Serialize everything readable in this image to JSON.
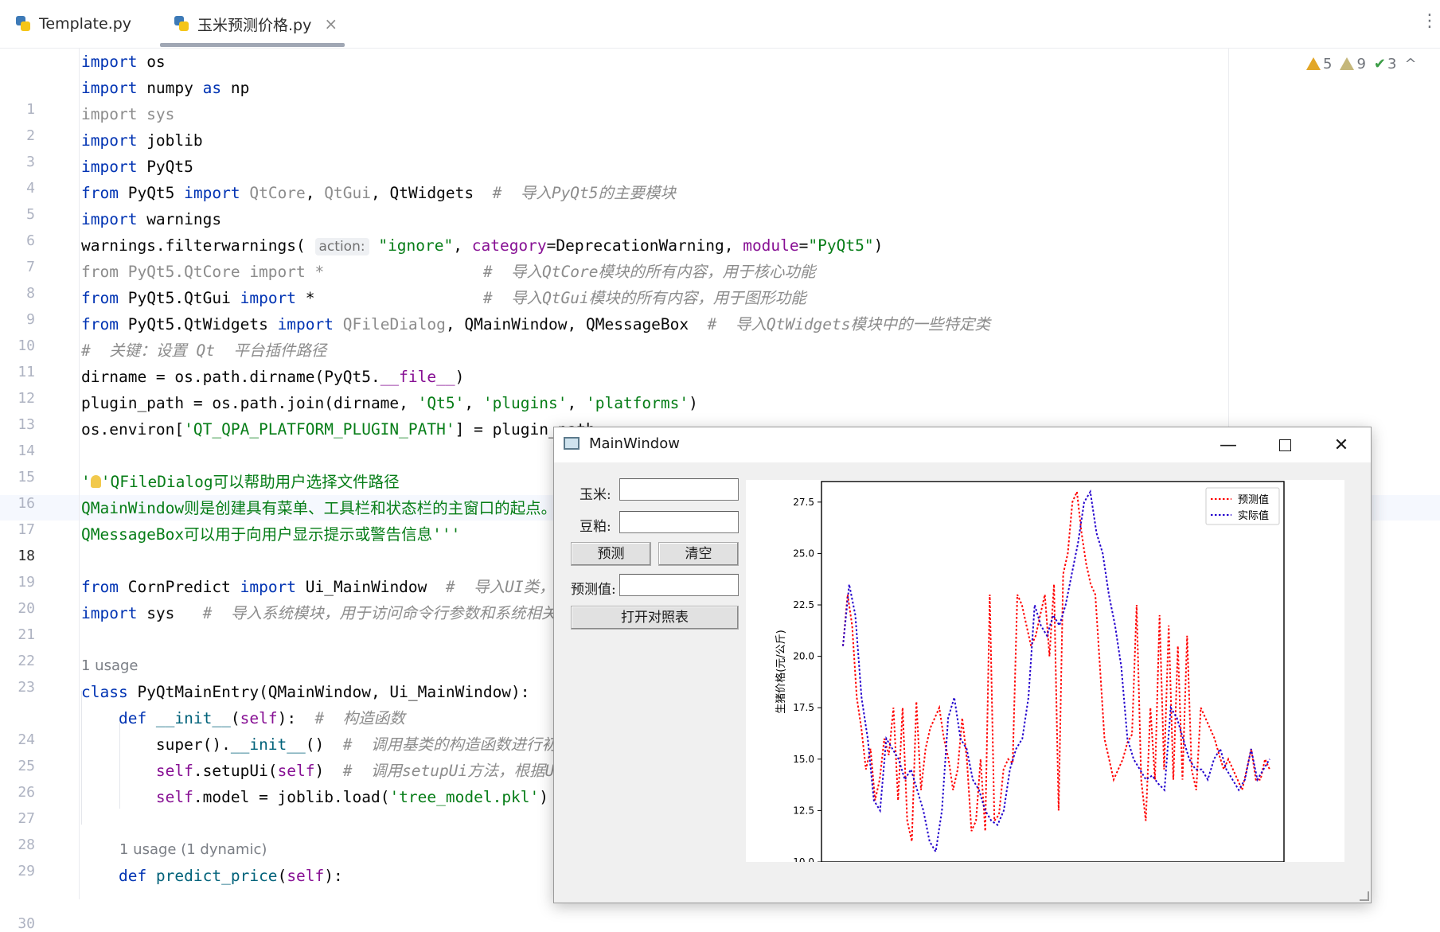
{
  "tabs": [
    {
      "label": "Template.py"
    },
    {
      "label": "玉米预测价格.py",
      "close": "×"
    }
  ],
  "tab_menu": "⋮",
  "inspections": {
    "warnings": "5",
    "weak_warnings": "9",
    "typos": "3",
    "collapse": "^"
  },
  "gutter_numbers": [
    "1",
    "2",
    "3",
    "4",
    "5",
    "6",
    "7",
    "8",
    "9",
    "10",
    "11",
    "12",
    "13",
    "14",
    "15",
    "16",
    "17",
    "18",
    "19",
    "20",
    "21",
    "22",
    "23",
    "24",
    "25",
    "26",
    "27",
    "28",
    "29",
    "30"
  ],
  "code": {
    "l1": [
      "import",
      " os"
    ],
    "l2": [
      "import",
      " numpy ",
      "as",
      " np"
    ],
    "l3": [
      "import sys"
    ],
    "l4": [
      "import",
      " joblib"
    ],
    "l5": [
      "import",
      " PyQt5"
    ],
    "l6": [
      "from",
      " PyQt5 ",
      "import",
      " QtCore",
      ", ",
      "QtGui",
      ", QtWidgets  ",
      "#  导入PyQt5的主要模块"
    ],
    "l7": [
      "import",
      " warnings"
    ],
    "l8": [
      "warnings.filterwarnings(",
      "action:",
      "\"ignore\"",
      ", ",
      "category",
      "=DeprecationWarning, ",
      "module",
      "=",
      "\"PyQt5\"",
      ")"
    ],
    "l9": [
      "from PyQt5.QtCore import *",
      "                 #  导入QtCore模块的所有内容，用于核心功能"
    ],
    "l10": [
      "from",
      " PyQt5.QtGui ",
      "import",
      " *",
      "                  #  导入QtGui模块的所有内容，用于图形功能"
    ],
    "l11": [
      "from",
      " PyQt5.QtWidgets ",
      "import",
      " QFileDialog",
      ", QMainWindow, QMessageBox  ",
      "#  导入QtWidgets模块中的一些特定类"
    ],
    "l12": [
      "#  关键：设置 Qt  平台插件路径"
    ],
    "l13": [
      "dirname = os.path.dirname(PyQt5.",
      "__file__",
      ")"
    ],
    "l14": [
      "plugin_path = os.path.join(dirname, ",
      "'Qt5'",
      ", ",
      "'plugins'",
      ", ",
      "'platforms'",
      ")"
    ],
    "l15": [
      "os.environ[",
      "'QT_QPA_PLATFORM_PLUGIN_PATH'",
      "] = plugin_path"
    ],
    "l17": [
      "'",
      "'QFileDialog可以帮助用户选择文件路径"
    ],
    "l18": [
      "QMainWindow则是创建具有菜单、工具栏和状态栏的主窗口的起点。"
    ],
    "l19": [
      "QMessageBox可以用于向用户显示提示或警告信息'''"
    ],
    "l21": [
      "from",
      " CornPredict ",
      "import",
      " Ui_MainWindow  ",
      "#  导入UI类，"
    ],
    "l22": [
      "import",
      " sys   ",
      "#  导入系统模块，用于访问命令行参数和系统相关功"
    ],
    "usage1": "1 usage",
    "l24": [
      "class",
      " PyQtMainEntry(QMainWindow, Ui_MainWindow):"
    ],
    "l25": [
      "    def",
      " __init__",
      "(",
      "self",
      "):  ",
      "#  构造函数"
    ],
    "l26": [
      "        super().",
      "__init__",
      "()  ",
      "#  调用基类的构造函数进行初"
    ],
    "l27": [
      "        ",
      "self",
      ".setupUi(",
      "self",
      ")  ",
      "#  调用setupUi方法，根据Ui"
    ],
    "l28": [
      "        ",
      "self",
      ".model = joblib.load(",
      "'tree_model.pkl'",
      ")"
    ],
    "usage2": "1 usage (1 dynamic)",
    "l30": [
      "    def",
      " predict_price",
      "(",
      "self",
      "):"
    ]
  },
  "qt_window": {
    "title": "MainWindow",
    "min": "—",
    "close": "✕",
    "labels": {
      "corn": "玉米:",
      "soy": "豆粕:",
      "pred": "预测值:"
    },
    "inputs": {
      "corn": "",
      "soy": "",
      "pred": ""
    },
    "buttons": {
      "predict": "预测",
      "clear": "清空",
      "open_table": "打开对照表"
    }
  },
  "chart_data": {
    "type": "line",
    "ylabel": "生猪价格(元/公斤)",
    "ylim": [
      10.0,
      28.5
    ],
    "yticks": [
      "10.0",
      "12.5",
      "15.0",
      "17.5",
      "20.0",
      "22.5",
      "25.0",
      "27.5"
    ],
    "ytick_values": [
      10.0,
      12.5,
      15.0,
      17.5,
      20.0,
      22.5,
      25.0,
      27.5
    ],
    "legend_position": "top-right",
    "colors": {
      "predicted": "#ff0000",
      "actual": "#2200cc"
    },
    "series": [
      {
        "name": "预测值",
        "style": "dotted",
        "color": "#ff0000",
        "values": [
          20.5,
          23.0,
          21.5,
          18.0,
          16.5,
          14.5,
          15.5,
          13.0,
          14.0,
          16.0,
          15.2,
          17.5,
          13.0,
          17.5,
          12.0,
          11.0,
          17.8,
          13.5,
          15.5,
          16.5,
          17.0,
          17.5,
          16.0,
          15.0,
          13.5,
          14.5,
          17.0,
          15.0,
          11.5,
          12.0,
          15.0,
          11.5,
          23.0,
          12.0,
          12.3,
          14.5,
          15.0,
          14.8,
          23.0,
          22.5,
          21.5,
          20.5,
          21.0,
          22.0,
          23.0,
          20.0,
          23.5,
          12.5,
          24.0,
          25.0,
          27.5,
          28.0,
          26.0,
          24.5,
          23.5,
          23.0,
          19.5,
          16.0,
          15.0,
          14.0,
          14.5,
          15.0,
          15.8,
          16.2,
          22.5,
          14.0,
          12.0,
          17.5,
          14.0,
          22.0,
          14.5,
          21.5,
          14.0,
          20.5,
          14.0,
          21.0,
          14.5,
          13.5,
          17.5,
          17.0,
          16.5,
          16.0,
          15.2,
          14.5,
          15.0,
          14.5,
          14.0,
          13.5,
          14.5,
          15.5,
          14.0,
          14.0,
          15.0,
          14.5
        ]
      },
      {
        "name": "实际值",
        "style": "dotted",
        "color": "#2200cc",
        "values": [
          20.5,
          23.5,
          22.0,
          18.0,
          16.0,
          13.0,
          12.5,
          16.0,
          15.5,
          15.0,
          14.0,
          14.5,
          13.5,
          12.5,
          11.0,
          10.5,
          12.5,
          17.0,
          18.0,
          16.0,
          15.5,
          14.0,
          13.5,
          12.5,
          12.0,
          11.8,
          12.5,
          14.5,
          15.5,
          16.0,
          18.0,
          22.5,
          21.5,
          21.0,
          22.0,
          21.5,
          22.5,
          24.0,
          25.5,
          27.5,
          28.0,
          26.0,
          25.0,
          23.0,
          21.5,
          19.5,
          16.0,
          15.0,
          14.5,
          14.0,
          14.2,
          13.8,
          13.5,
          17.5,
          17.0,
          16.0,
          15.0,
          14.5,
          14.5,
          14.0,
          15.0,
          15.5,
          14.5,
          14.0,
          13.5,
          14.0,
          15.5,
          14.0,
          14.5,
          15.0
        ]
      }
    ]
  }
}
